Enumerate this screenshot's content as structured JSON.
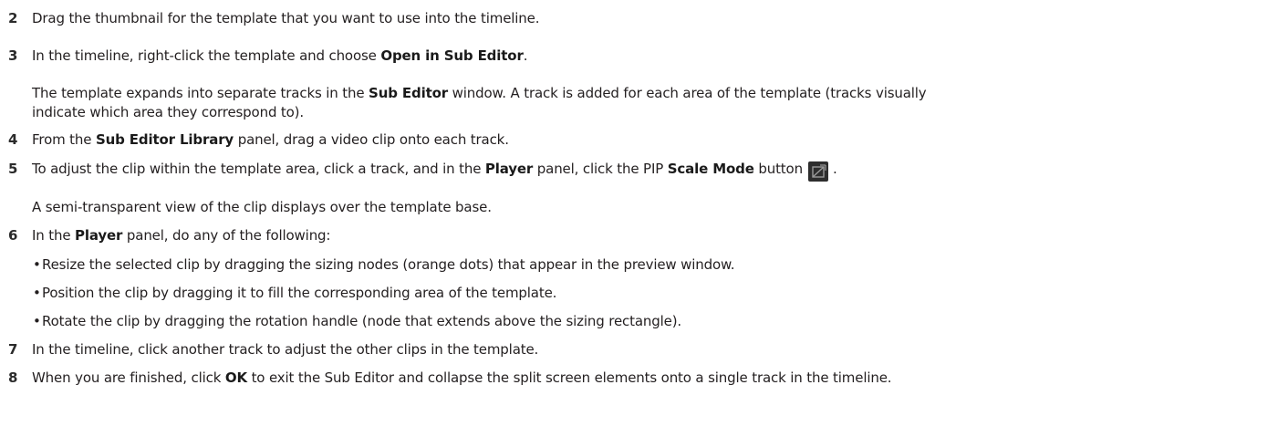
{
  "steps": [
    {
      "num": "2",
      "lines": [
        {
          "parts": [
            "Drag the thumbnail for the template that you want to use into the timeline."
          ]
        }
      ]
    },
    {
      "num": "3",
      "lines": [
        {
          "parts": [
            "In the timeline, right-click the template and choose ",
            "Open in Sub Editor",
            "."
          ]
        }
      ]
    },
    {
      "note_lines": [
        {
          "parts": [
            "The template expands into separate tracks in the ",
            "Sub Editor",
            " window. A track is added for each area of the template (tracks visually"
          ]
        },
        {
          "parts": [
            "indicate which area they correspond to)."
          ]
        }
      ]
    },
    {
      "num": "4",
      "lines": [
        {
          "parts": [
            "From the ",
            "Sub Editor Library",
            " panel, drag a video clip onto each track."
          ]
        }
      ]
    },
    {
      "num": "5",
      "lines": [
        {
          "parts": [
            "To adjust the clip within the template area, click a track, and in the ",
            "Player",
            " panel, click the PIP ",
            "Scale Mode",
            " button",
            "."
          ]
        }
      ],
      "icon": "scale-mode-icon"
    },
    {
      "note_lines": [
        {
          "parts": [
            "A semi-transparent view of the clip displays over the template base."
          ]
        }
      ]
    },
    {
      "num": "6",
      "lines": [
        {
          "parts": [
            "In the ",
            "Player",
            " panel, do any of the following:"
          ]
        }
      ]
    },
    {
      "bullets": [
        "Resize the selected clip by dragging the sizing nodes (orange dots) that appear in the preview window.",
        "Position the clip by dragging it to fill the corresponding area of the template.",
        "Rotate the clip by dragging the rotation handle (node that extends above the sizing rectangle)."
      ]
    },
    {
      "num": "7",
      "lines": [
        {
          "parts": [
            "In the timeline, click another track to adjust the other clips in the template."
          ]
        }
      ]
    },
    {
      "num": "8",
      "lines": [
        {
          "parts": [
            "When you are finished, click ",
            "OK",
            " to exit the Sub Editor and collapse the split screen elements onto a single track in the timeline."
          ]
        }
      ]
    }
  ],
  "flat": {
    "s2_num": "2",
    "s2_text": "Drag the thumbnail for the template that you want to use into the timeline.",
    "s3_num": "3",
    "s3_a": "In the timeline, right-click the template and choose ",
    "s3_b": "Open in Sub Editor",
    "s3_c": ".",
    "n1_a": "The template expands into separate tracks in the ",
    "n1_b": "Sub Editor",
    "n1_c": " window. A track is added for each area of the template (tracks visually",
    "n1_d": "indicate which area they correspond to).",
    "s4_num": "4",
    "s4_a": "From the ",
    "s4_b": "Sub Editor Library",
    "s4_c": " panel, drag a video clip onto each track.",
    "s5_num": "5",
    "s5_a": "To adjust the clip within the template area, click a track, and in the ",
    "s5_b": "Player",
    "s5_c": " panel, click the PIP ",
    "s5_d": "Scale Mode",
    "s5_e": " button",
    "s5_f": ".",
    "n2": "A semi-transparent view of the clip displays over the template base.",
    "s6_num": "6",
    "s6_a": "In the ",
    "s6_b": "Player",
    "s6_c": " panel, do any of the following:",
    "b1": "Resize the selected clip by dragging the sizing nodes (orange dots) that appear in the preview window.",
    "b2": "Position the clip by dragging it to fill the corresponding area of the template.",
    "b3": "Rotate the clip by dragging the rotation handle (node that extends above the sizing rectangle).",
    "bullet_glyph": "•",
    "s7_num": "7",
    "s7_text": "In the timeline, click another track to adjust the other clips in the template.",
    "s8_num": "8",
    "s8_a": "When you are finished, click ",
    "s8_b": "OK",
    "s8_c": " to exit the Sub Editor and collapse the split screen elements onto a single track in the timeline."
  },
  "icon_colors": {
    "background": "#2d2d2d",
    "stroke": "#9a9a9a"
  }
}
